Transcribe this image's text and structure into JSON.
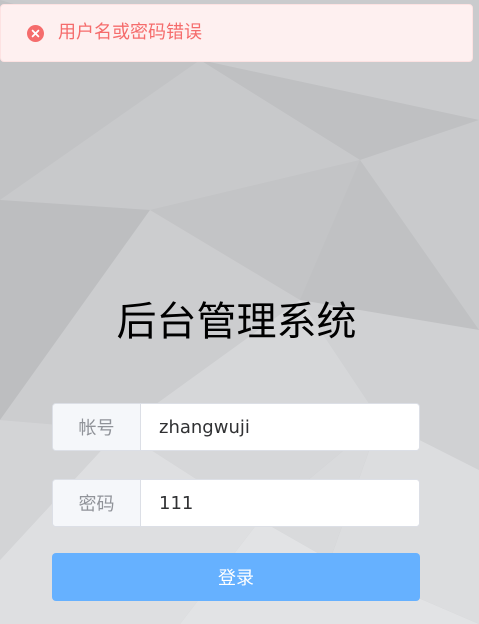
{
  "alert": {
    "type": "error",
    "icon": "circle-close-icon",
    "message": "用户名或密码错误",
    "color": "#f56c6c",
    "background": "#fef0f0"
  },
  "page": {
    "title": "后台管理系统"
  },
  "form": {
    "username": {
      "label": "帐号",
      "value": "zhangwuji"
    },
    "password": {
      "label": "密码",
      "value": "111"
    },
    "submit_label": "登录",
    "accent": "#66b1ff"
  }
}
